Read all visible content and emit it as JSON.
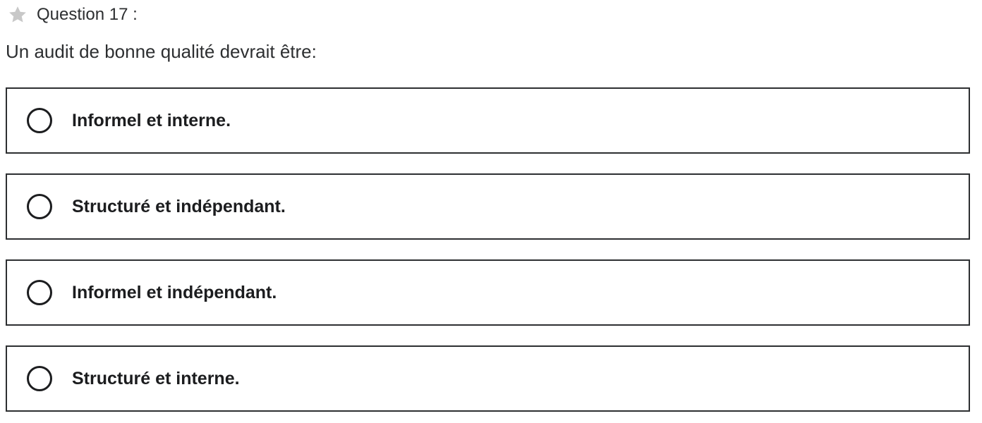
{
  "question": {
    "star_icon": "star-icon",
    "number_label": "Question 17 :",
    "prompt": "Un audit de bonne qualité devrait être:"
  },
  "options": [
    {
      "label": "Informel et interne.",
      "selected": false
    },
    {
      "label": "Structuré et indépendant.",
      "selected": false
    },
    {
      "label": "Informel et indépendant.",
      "selected": false
    },
    {
      "label": "Structuré et interne.",
      "selected": false
    }
  ],
  "colors": {
    "text": "#1c1d1f",
    "border": "#2d2f31",
    "star": "#c8c8c8",
    "background": "#ffffff"
  }
}
